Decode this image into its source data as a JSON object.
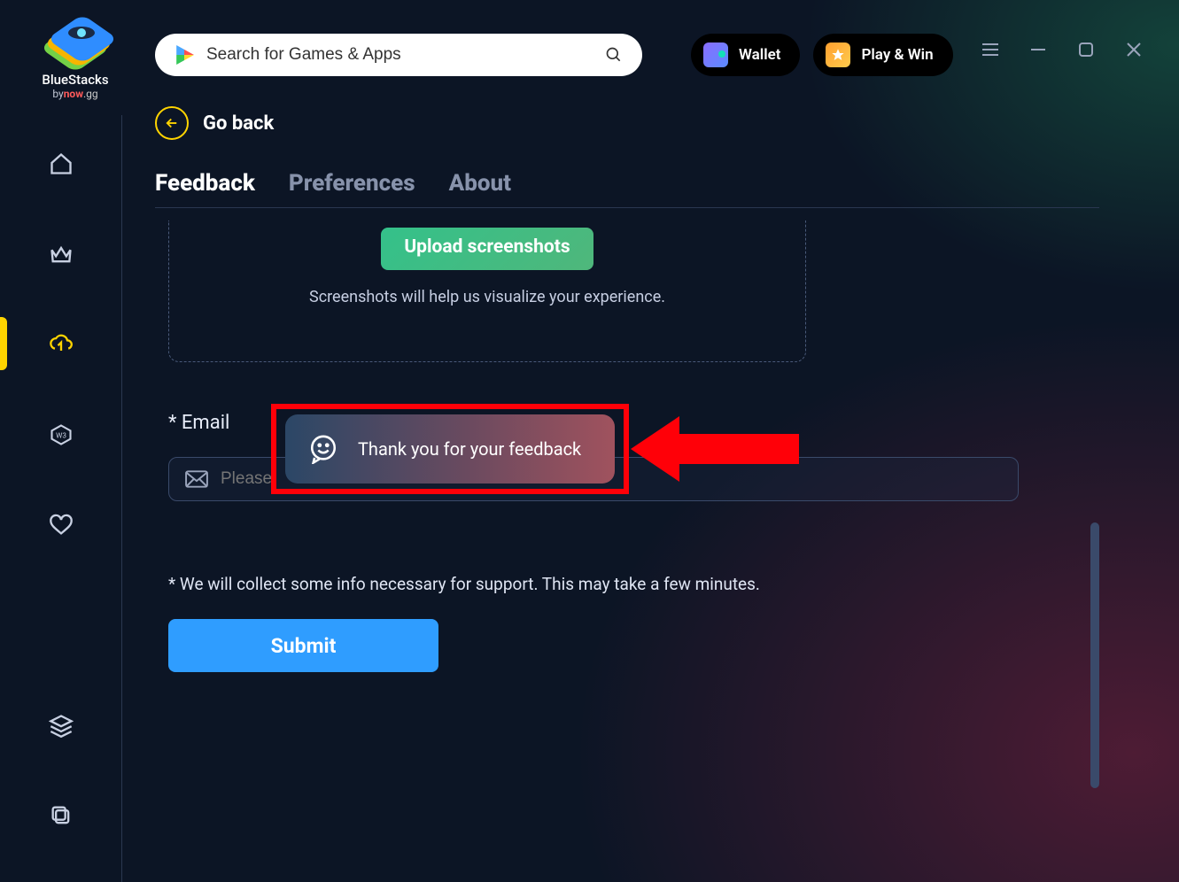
{
  "brand": {
    "name": "BlueStacks",
    "sub_prefix": "by",
    "sub_now": "now",
    "sub_gg": ".gg"
  },
  "search": {
    "placeholder": "Search for Games & Apps"
  },
  "header": {
    "wallet": "Wallet",
    "playwin": "Play & Win"
  },
  "nav": {
    "go_back": "Go back"
  },
  "tabs": {
    "feedback": "Feedback",
    "preferences": "Preferences",
    "about": "About"
  },
  "upload": {
    "button": "Upload screenshots",
    "hint": "Screenshots will help us visualize your experience."
  },
  "email": {
    "label": "* Email",
    "placeholder": "Please"
  },
  "disclaimer": "* We will collect some info necessary for support. This may take a few minutes.",
  "submit": "Submit",
  "toast": "Thank you for your feedback"
}
